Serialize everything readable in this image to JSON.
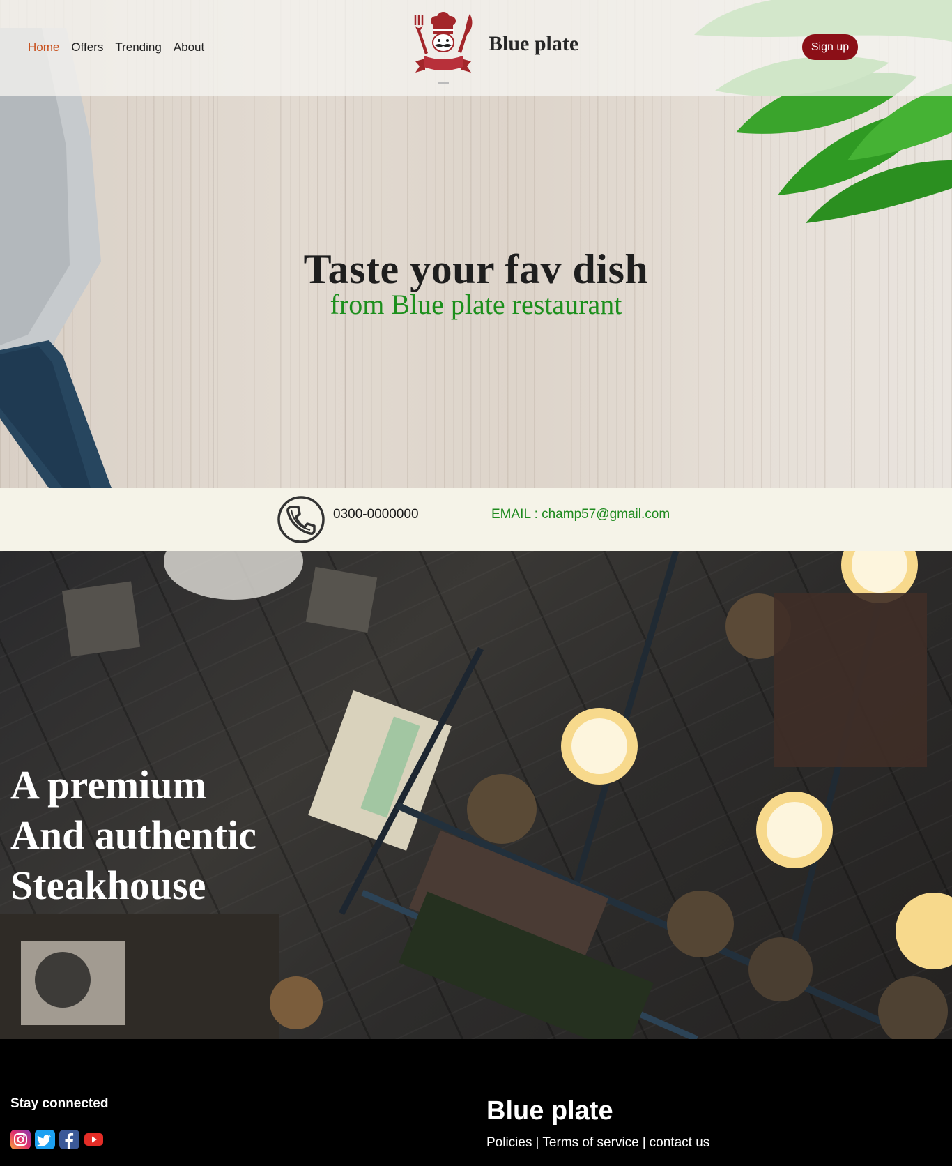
{
  "nav": {
    "items": [
      {
        "label": "Home",
        "active": true
      },
      {
        "label": "Offers",
        "active": false
      },
      {
        "label": "Trending",
        "active": false
      },
      {
        "label": "About",
        "active": false
      }
    ],
    "brand": "Blue plate",
    "signup_label": "Sign up"
  },
  "hero": {
    "title": "Taste your fav dish",
    "subtitle": "from Blue plate restaurant"
  },
  "contact": {
    "phone_icon": "phone-icon",
    "phone": "0300-0000000",
    "email": "EMAIL : champ57@gmail.com"
  },
  "feature": {
    "lines": [
      "A premium",
      "And authentic",
      "Steakhouse"
    ]
  },
  "footer": {
    "stay_connected": "Stay connected",
    "social": [
      "instagram-icon",
      "twitter-icon",
      "facebook-icon",
      "youtube-icon"
    ],
    "brand": "Blue plate",
    "links": [
      "Policies",
      "Terms of service",
      "contact us"
    ],
    "separator": "|"
  },
  "colors": {
    "nav_active": "#c8511e",
    "signup_bg": "#8b0f17",
    "hero_subtitle": "#1c8f1c",
    "email": "#1e8a1e",
    "contact_bg": "#f5f3e8",
    "footer_bg": "#000000"
  }
}
